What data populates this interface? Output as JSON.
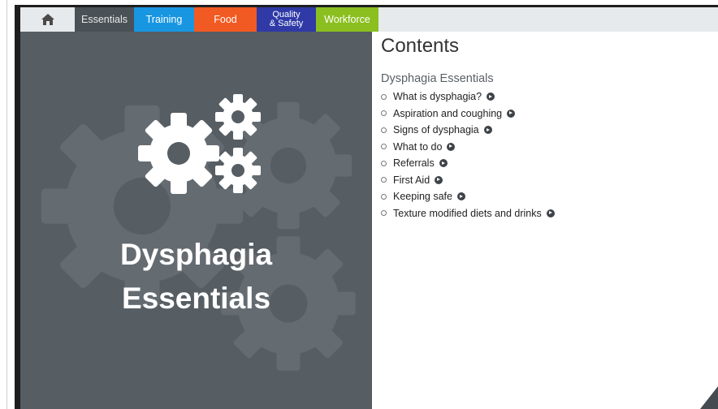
{
  "nav": {
    "home_icon": "home-icon",
    "tabs": [
      {
        "label": "Essentials",
        "color": "#4a5157"
      },
      {
        "label": "Training",
        "color": "#1896e2"
      },
      {
        "label": "Food",
        "color": "#f15a22"
      },
      {
        "label": "Quality & Safety",
        "line1": "Quality",
        "line2": "& Safety",
        "color": "#2f3aa6"
      },
      {
        "label": "Workforce",
        "color": "#8bbf1f"
      }
    ]
  },
  "hero": {
    "icon": "gears-icon",
    "title_line1": "Dysphagia",
    "title_line2": "Essentials",
    "background": "#565d63"
  },
  "contents": {
    "heading": "Contents",
    "section": "Dysphagia Essentials",
    "items": [
      "What is dysphagia?",
      "Aspiration and coughing",
      "Signs of dysphagia",
      "What to do",
      "Referrals",
      "First Aid",
      "Keeping safe",
      "Texture modified diets and drinks"
    ]
  }
}
